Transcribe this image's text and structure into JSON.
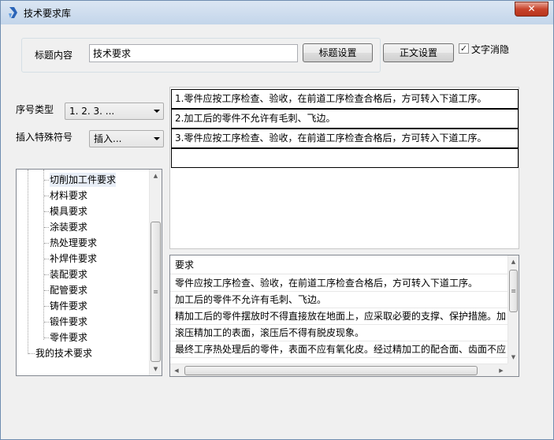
{
  "window": {
    "title": "技术要求库",
    "close_glyph": "✕"
  },
  "title_section": {
    "label": "标题内容",
    "value": "技术要求",
    "title_settings_button": "标题设置",
    "body_settings_button": "正文设置",
    "checkbox_label": "文字消隐",
    "checkbox_checked": true,
    "checkbox_glyph": "✓"
  },
  "numbering": {
    "label": "序号类型",
    "value": "1. 2. 3. ..."
  },
  "special_symbol": {
    "label": "插入特殊符号",
    "value": "插入..."
  },
  "tree": {
    "items": [
      "切削加工件要求",
      "材料要求",
      "模具要求",
      "涂装要求",
      "热处理要求",
      "补焊件要求",
      "装配要求",
      "配管要求",
      "铸件要求",
      "锻件要求",
      "零件要求"
    ],
    "root_item": "我的技术要求"
  },
  "editor": {
    "rows": [
      "1.零件应按工序检查、验收，在前道工序检查合格后，方可转入下道工序。",
      "2.加工后的零件不允许有毛刺、飞边。",
      "3.零件应按工序检查、验收，在前道工序检查合格后，方可转入下道工序。",
      ""
    ]
  },
  "requirements_list": {
    "header": "要求",
    "rows": [
      "零件应按工序检查、验收，在前道工序检查合格后，方可转入下道工序。",
      "加工后的零件不允许有毛刺、飞边。",
      "精加工后的零件摆放时不得直接放在地面上，应采取必要的支撑、保护措施。加",
      "滚压精加工的表面，滚压后不得有脱皮现象。",
      "最终工序热处理后的零件，表面不应有氧化皮。经过精加工的配合面、齿面不应"
    ]
  }
}
